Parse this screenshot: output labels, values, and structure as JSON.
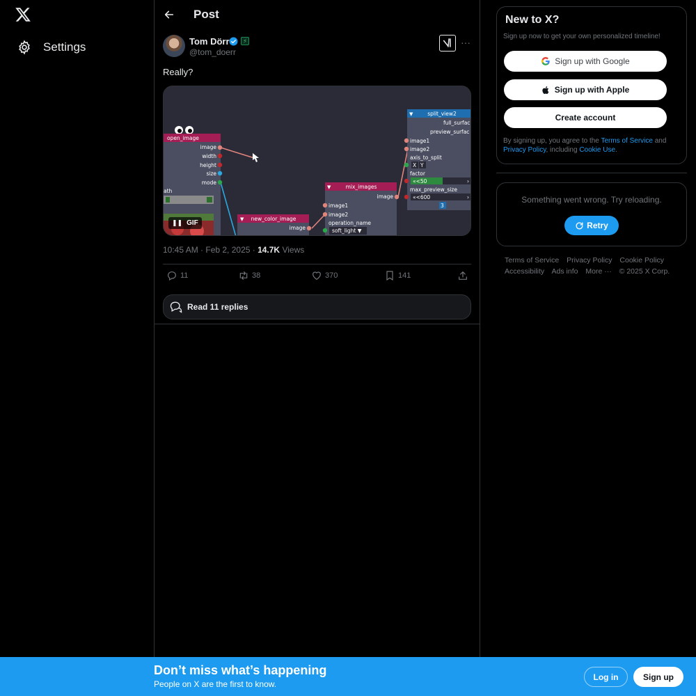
{
  "nav": {
    "settings_label": "Settings",
    "logo_icon": "x-logo-icon",
    "settings_icon": "gear-icon"
  },
  "header": {
    "title": "Post"
  },
  "post": {
    "author_name": "Tom Dörr",
    "author_handle": "@tom_doerr",
    "text": "Really?",
    "timestamp": "10:45 AM · Feb 2, 2025 · ",
    "views": "14.7K",
    "views_label": " Views",
    "media": {
      "gif_label": "GIF",
      "pause_icon": "pause-icon",
      "nodes": {
        "open_image": {
          "title": "open_image",
          "outputs": [
            "image",
            "width",
            "height",
            "size",
            "mode"
          ]
        },
        "path_label": "ath",
        "new_color_image": {
          "title": "new_color_image",
          "outputs": [
            "image"
          ]
        },
        "mix_images": {
          "title": "mix_images",
          "output": "image",
          "inputs": [
            "image1",
            "image2",
            "operation_name"
          ],
          "operation_value": "soft_light ▼"
        },
        "split_view2": {
          "title": "split_view2",
          "outputs": [
            "full_surfac",
            "preview_surfac"
          ],
          "inputs": [
            "image1",
            "image2",
            "axis_to_split"
          ],
          "axis_x": "X",
          "axis_y": "Y",
          "factor_label": "factor",
          "factor_value": "«<50",
          "max_preview_label": "max_preview_size",
          "max_preview_value": "«<600",
          "counter": "3"
        }
      }
    },
    "stats": {
      "replies": "11",
      "reposts": "38",
      "likes": "370",
      "bookmarks": "141"
    },
    "read_replies": "Read 11 replies"
  },
  "signup": {
    "title": "New to X?",
    "subtitle": "Sign up now to get your own personalized timeline!",
    "google_label": "Sign up with Google",
    "apple_label": "Sign up with Apple",
    "create_label": "Create account",
    "terms_prefix": "By signing up, you agree to the ",
    "terms_link": "Terms of Service",
    "terms_and": " and ",
    "privacy_link": "Privacy Policy",
    "terms_including": ", including ",
    "cookie_link": "Cookie Use",
    "terms_end": "."
  },
  "error": {
    "message": "Something went wrong. Try reloading.",
    "retry_label": "Retry"
  },
  "footer": {
    "links": [
      "Terms of Service",
      "Privacy Policy",
      "Cookie Policy",
      "Accessibility",
      "Ads info",
      "More ···"
    ],
    "copyright": "© 2025 X Corp."
  },
  "bottom_bar": {
    "title": "Don’t miss what’s happening",
    "subtitle": "People on X are the first to know.",
    "login_label": "Log in",
    "signup_label": "Sign up"
  },
  "colors": {
    "accent": "#1d9bf0",
    "background": "#000000",
    "border": "#2f3336",
    "muted": "#71767b"
  }
}
